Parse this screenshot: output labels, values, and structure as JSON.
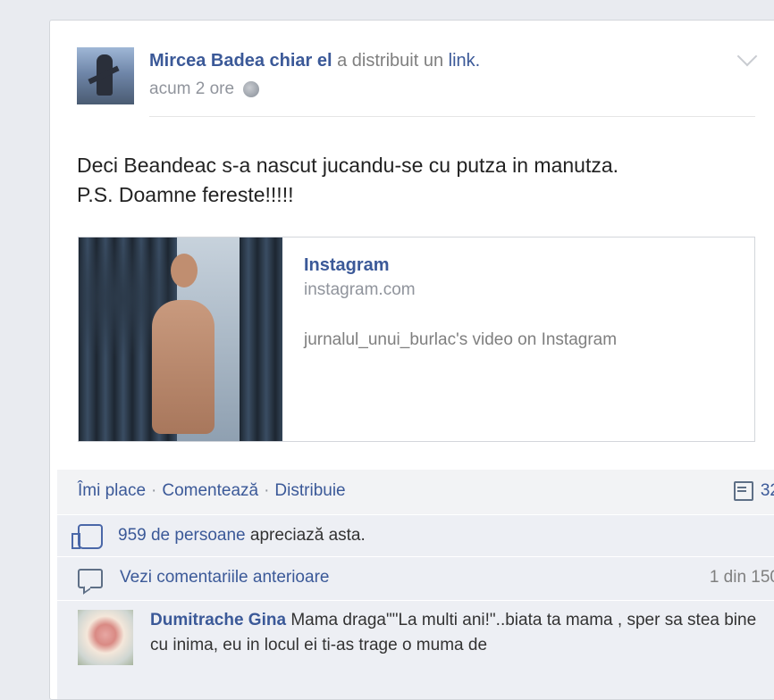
{
  "post": {
    "author": "Mircea Badea chiar el",
    "action": "a distribuit un",
    "action_link": "link.",
    "time": "acum 2 ore",
    "text_line1": "Deci Beandeac s-a nascut jucandu-se cu putza in manutza.",
    "text_line2": "P.S. Doamne fereste!!!!!"
  },
  "link": {
    "title": "Instagram",
    "domain": "instagram.com",
    "description": "jurnalul_unui_burlac's video on Instagram"
  },
  "actions": {
    "like": "Îmi place",
    "comment": "Comentează",
    "share": "Distribuie",
    "separator": "·",
    "comment_count": "32"
  },
  "likes": {
    "count_text": "959 de persoane",
    "suffix": "apreciază asta."
  },
  "previous": {
    "label": "Vezi comentariile anterioare",
    "pager": "1 din 150"
  },
  "comment": {
    "name": "Dumitrache Gina",
    "text": "Mama draga\"\"La multi ani!\"..biata ta mama , sper sa stea bine cu inima, eu in locul ei ti-as trage o muma de"
  },
  "icons": {
    "globe": "globe-icon",
    "chevron": "chevron-down-icon",
    "comments": "comments-icon",
    "like": "thumbs-up-icon",
    "bubble": "comment-bubble-icon"
  }
}
